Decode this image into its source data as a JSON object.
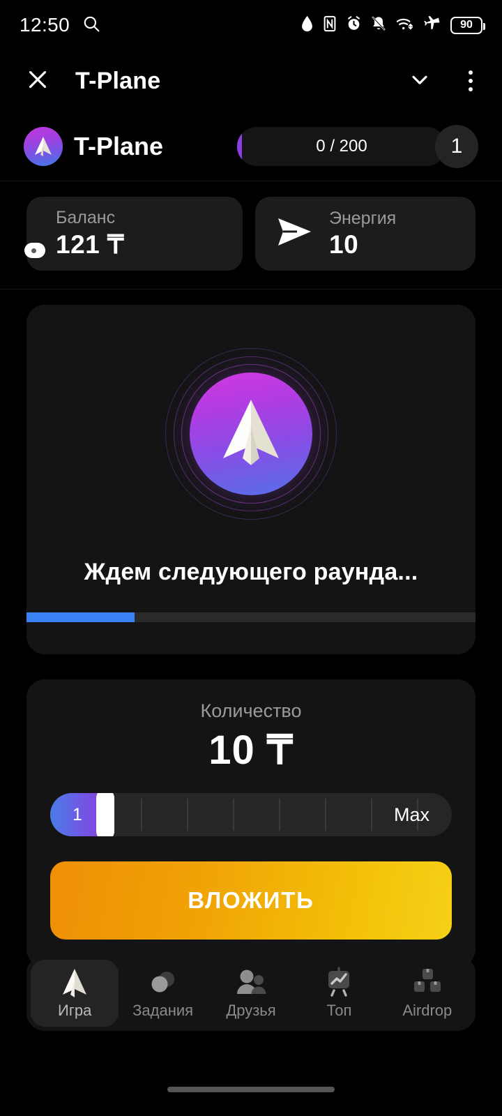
{
  "status_bar": {
    "time": "12:50",
    "search_icon": "search-icon",
    "icons": [
      "water-drop-icon",
      "nfc-icon",
      "alarm-icon",
      "bell-muted-icon",
      "wifi-icon",
      "airplane-mode-icon"
    ],
    "battery_level": "90"
  },
  "app_bar": {
    "close_label": "close-icon",
    "title": "T-Plane",
    "expand_label": "chevron-down-icon",
    "menu_label": "more-options-icon"
  },
  "mini_header": {
    "brand_name": "T-Plane",
    "xp_text": "0 / 200",
    "xp_current": 0,
    "xp_max": 200,
    "level": "1"
  },
  "stats": [
    {
      "label": "Баланс",
      "value": "121 ₸",
      "icon": "wallet-icon"
    },
    {
      "label": "Энергия",
      "value": "10",
      "icon": "send-arrow-icon"
    }
  ],
  "game_card": {
    "status_text": "Ждем следующего раунда...",
    "progress_percent": 24,
    "logo_icon": "paper-plane-logo-icon"
  },
  "bet_card": {
    "amount_label": "Количество",
    "amount_value": "10 ₸",
    "slider_value": "1",
    "slider_max_label": "Max"
  },
  "invest_button": {
    "label": "ВЛОЖИТЬ"
  },
  "bottom_nav": {
    "items": [
      {
        "label": "Игра",
        "icon": "paper-plane-icon",
        "active": true
      },
      {
        "label": "Задания",
        "icon": "circles-icon",
        "active": false
      },
      {
        "label": "Друзья",
        "icon": "people-icon",
        "active": false
      },
      {
        "label": "Топ",
        "icon": "chart-board-icon",
        "active": false
      },
      {
        "label": "Airdrop",
        "icon": "boxes-icon",
        "active": false
      }
    ]
  },
  "colors": {
    "background": "#000000",
    "card": "#141414",
    "accent_purple": "#8b3fe0",
    "accent_blue": "#3b82f6",
    "button_orange": "#ef8f07",
    "button_yellow": "#f5d116"
  }
}
